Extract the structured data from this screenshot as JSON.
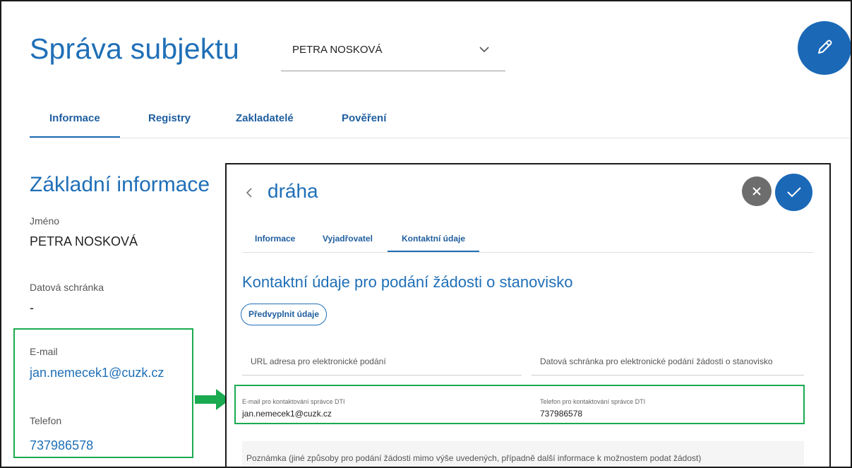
{
  "header": {
    "title": "Správa subjektu",
    "subject_select": {
      "value": "PETRA NOSKOVÁ"
    }
  },
  "main_tabs": [
    {
      "label": "Informace"
    },
    {
      "label": "Registry"
    },
    {
      "label": "Zakladatelé"
    },
    {
      "label": "Pověření"
    }
  ],
  "basic_info": {
    "title": "Základní informace",
    "fields": [
      {
        "label": "Jméno",
        "value": "PETRA NOSKOVÁ"
      },
      {
        "label": "Datová schránka",
        "value": "-"
      },
      {
        "label": "E-mail",
        "value": "jan.nemecek1@cuzk.cz"
      },
      {
        "label": "Telefon",
        "value": "737986578"
      }
    ]
  },
  "panel": {
    "title": "dráha",
    "tabs": [
      {
        "label": "Informace"
      },
      {
        "label": "Vyjadřovatel"
      },
      {
        "label": "Kontaktní údaje"
      }
    ],
    "section_title": "Kontaktní údaje pro podání žádosti o stanovisko",
    "prefill_label": "Předvyplnit údaje",
    "fields": {
      "url": {
        "placeholder": "URL adresa pro elektronické podání"
      },
      "databox": {
        "placeholder": "Datová schránka pro elektronické podání žádosti o stanovisko"
      },
      "email": {
        "label": "E-mail pro kontaktování správce DTI",
        "value": "jan.nemecek1@cuzk.cz"
      },
      "phone": {
        "label": "Telefon pro kontaktování správce DTI",
        "value": "737986578"
      },
      "note": {
        "placeholder": "Poznámka (jiné způsoby pro podání žádosti mimo výše uvedených, případně další informace k možnostem podat žádost)"
      }
    }
  },
  "colors": {
    "accent": "#1f6fb7",
    "fab": "#1b68b7",
    "highlight": "#1aaa50",
    "cancel": "#6d6d6d"
  },
  "icons": {
    "edit": "pencil-icon",
    "dropdown": "chevron-down-icon",
    "back": "chevron-left-icon",
    "close": "close-icon",
    "confirm": "check-icon",
    "annotation": "arrow-right-icon"
  }
}
